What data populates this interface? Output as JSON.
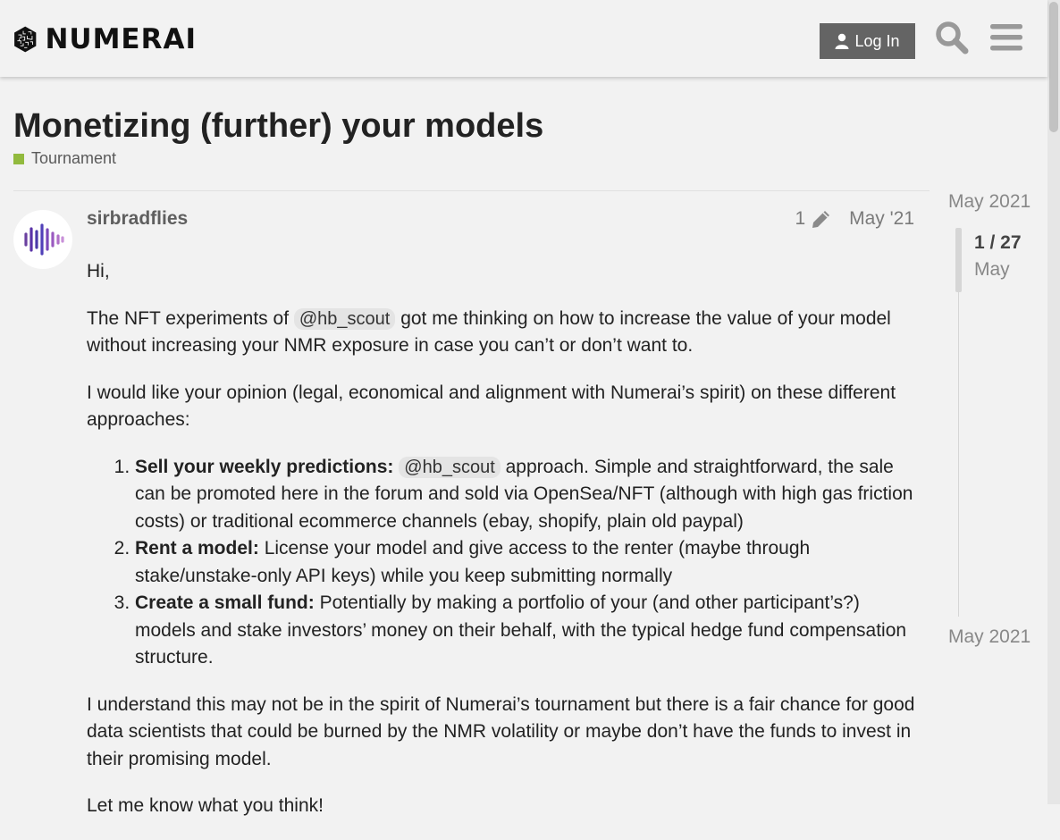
{
  "header": {
    "logo_text": "NUMERAI",
    "login_label": "Log In",
    "search_icon": "search-icon",
    "menu_icon": "hamburger-menu-icon"
  },
  "topic": {
    "title": "Monetizing (further) your models",
    "category": "Tournament",
    "category_color": "#92ba3e"
  },
  "post": {
    "username": "sirbradflies",
    "edit_count": "1",
    "date": "May '21",
    "greeting": "Hi,",
    "p1_before": "The NFT experiments of ",
    "mention": "@hb_scout",
    "p1_after": " got me thinking on how to increase the value of your model without increasing your NMR exposure in case you can’t or don’t want to.",
    "p2": "I would like your opinion (legal, economical and alignment with Numerai’s spirit) on these different approaches:",
    "list": [
      {
        "bold": "Sell your weekly predictions:",
        "mention": "@hb_scout",
        "text": " approach. Simple and straightforward, the sale can be promoted here in the forum and sold via OpenSea/NFT (although with high gas friction costs) or traditional ecommerce channels (ebay, shopify, plain old paypal)"
      },
      {
        "bold": "Rent a model:",
        "text": " License your model and give access to the renter (maybe through stake/unstake-only API keys) while you keep submitting normally"
      },
      {
        "bold": "Create a small fund:",
        "text": " Potentially by making a portfolio of your (and other participant’s?) models and stake investors’ money on their behalf, with the typical hedge fund compensation structure."
      }
    ],
    "p3": "I understand this may not be in the spirit of Numerai’s tournament but there is a fair chance for good data scientists that could be burned by the NMR volatility or maybe don’t have the funds to invest in their promising model.",
    "p4": "Let me know what you think!"
  },
  "timeline": {
    "top_date": "May 2021",
    "position": "1 / 27",
    "current_month": "May",
    "bottom_date": "May 2021"
  }
}
